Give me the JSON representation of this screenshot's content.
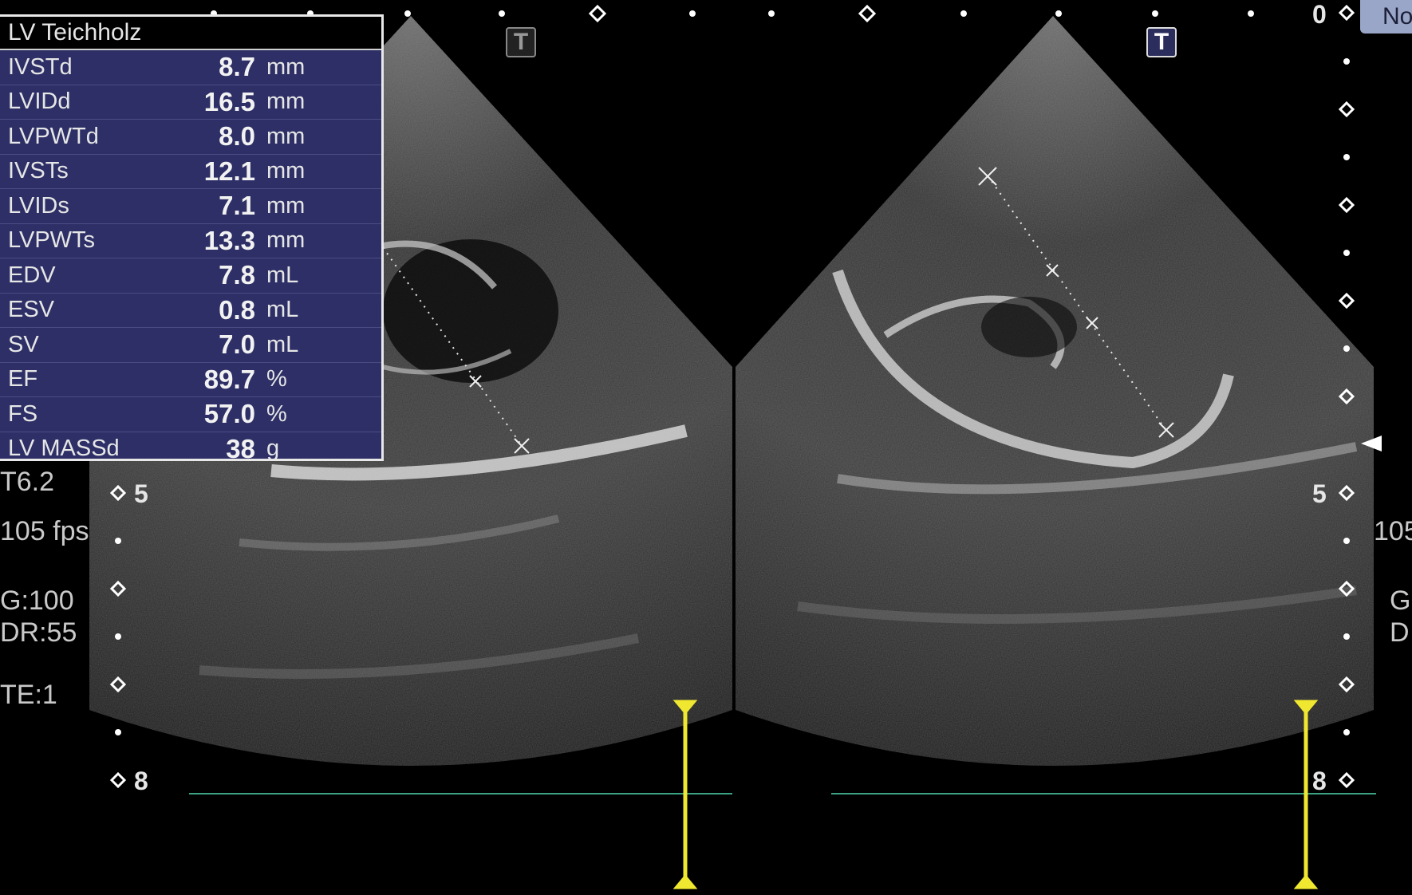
{
  "measurement_panel": {
    "title": "LV Teichholz",
    "rows": [
      {
        "label": "IVSTd",
        "value": "8.7",
        "unit": "mm"
      },
      {
        "label": "LVIDd",
        "value": "16.5",
        "unit": "mm"
      },
      {
        "label": "LVPWTd",
        "value": "8.0",
        "unit": "mm"
      },
      {
        "label": "IVSTs",
        "value": "12.1",
        "unit": "mm"
      },
      {
        "label": "LVIDs",
        "value": "7.1",
        "unit": "mm"
      },
      {
        "label": "LVPWTs",
        "value": "13.3",
        "unit": "mm"
      },
      {
        "label": "EDV",
        "value": "7.8",
        "unit": "mL"
      },
      {
        "label": "ESV",
        "value": "0.8",
        "unit": "mL"
      },
      {
        "label": "SV",
        "value": "7.0",
        "unit": "mL"
      },
      {
        "label": "EF",
        "value": "89.7",
        "unit": "%"
      },
      {
        "label": "FS",
        "value": "57.0",
        "unit": "%"
      },
      {
        "label": "LV MASSd",
        "value": "38",
        "unit": "g"
      }
    ]
  },
  "left_params": {
    "probe": "T6.2",
    "fps": "105 fps",
    "gain": "G:100",
    "dynamic_range": "DR:55",
    "te": "TE:1"
  },
  "right_params": {
    "fps": "105",
    "gain": "G",
    "dynamic_range": "D"
  },
  "depth_scale": {
    "top": "0",
    "mid": "5",
    "bottom": "8"
  },
  "tags": {
    "left_t": "T",
    "right_t": "T",
    "top_right": "No"
  },
  "colors": {
    "panel_bg": "#2d2f66",
    "caliper_yellow": "#f0e830",
    "baseline_green": "#3aa383"
  }
}
